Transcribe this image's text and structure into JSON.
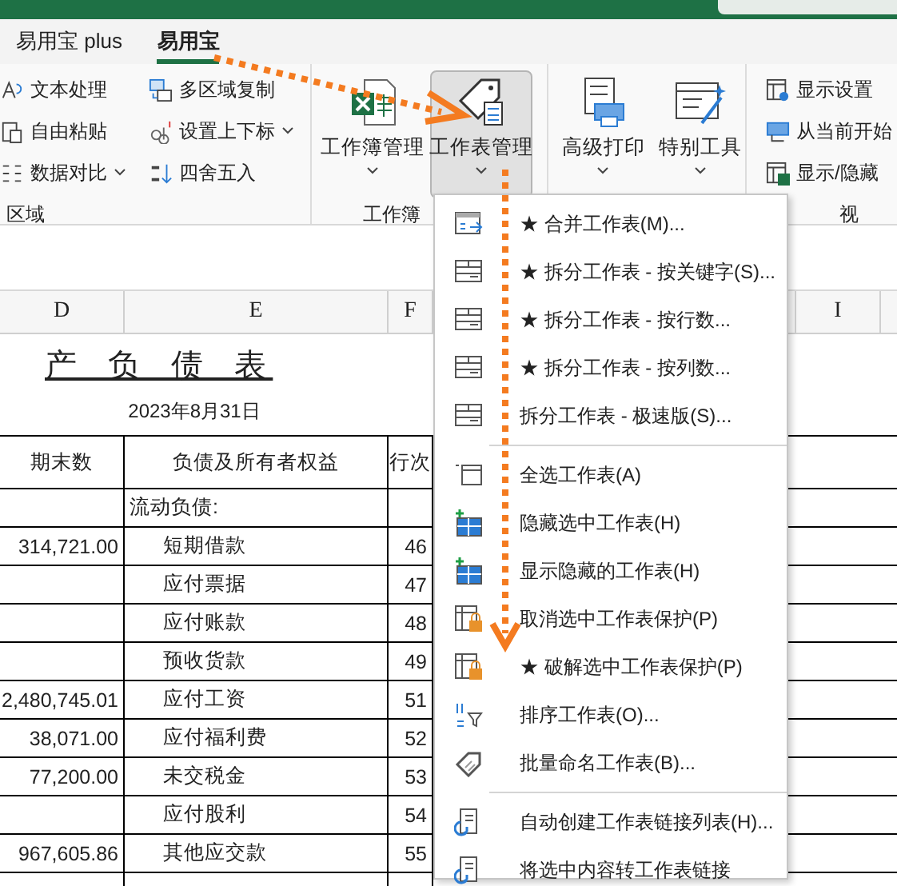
{
  "ribbon": {
    "tabs": [
      {
        "label": "易用宝 plus",
        "selected": false
      },
      {
        "label": "易用宝",
        "selected": true
      }
    ],
    "groups": [
      {
        "kind": "small",
        "label": "区域",
        "columns": [
          [
            {
              "label": "文本处理",
              "kind": "text",
              "dropdown": false
            },
            {
              "label": "自由粘贴",
              "kind": "paste",
              "dropdown": false
            },
            {
              "label": "数据对比",
              "kind": "compare",
              "dropdown": true
            }
          ],
          [
            {
              "label": "多区域复制",
              "kind": "copy",
              "dropdown": false
            },
            {
              "label": "设置上下标",
              "kind": "script",
              "dropdown": true
            },
            {
              "label": "四舍五入",
              "kind": "round",
              "dropdown": false
            }
          ]
        ]
      },
      {
        "kind": "large",
        "label": "工作簿",
        "buttons": [
          {
            "label": "工作簿管理",
            "kind": "workbook",
            "pressed": false
          },
          {
            "label": "工作表管理",
            "kind": "tag",
            "pressed": true
          }
        ]
      },
      {
        "kind": "large",
        "buttons": [
          {
            "label": "高级打印",
            "kind": "print",
            "pressed": false
          },
          {
            "label": "特别工具",
            "kind": "wand",
            "pressed": false
          }
        ]
      },
      {
        "kind": "small",
        "label": "视",
        "columns": [
          [
            {
              "label": "显示设置",
              "kind": "settings",
              "dropdown": false
            },
            {
              "label": "从当前开始",
              "kind": "screen",
              "dropdown": false
            },
            {
              "label": "显示/隐藏",
              "kind": "sheetx",
              "dropdown": false
            }
          ]
        ]
      }
    ]
  },
  "sheet": {
    "columns": [
      "D",
      "E",
      "F"
    ],
    "right_column": "I",
    "title": "产 负 债 表",
    "date": "2023年8月31日",
    "header": [
      "期末数",
      "负债及所有者权益",
      "行次"
    ],
    "rows": [
      {
        "kind": "section",
        "end_value": "",
        "item": "流动负债:",
        "line": ""
      },
      {
        "kind": "item",
        "end_value": "314,721.00",
        "item": "短期借款",
        "line": "46"
      },
      {
        "kind": "item",
        "end_value": "",
        "item": "应付票据",
        "line": "47"
      },
      {
        "kind": "item",
        "end_value": "",
        "item": "应付账款",
        "line": "48"
      },
      {
        "kind": "item",
        "end_value": "",
        "item": "预收货款",
        "line": "49"
      },
      {
        "kind": "item",
        "end_value": "2,480,745.01",
        "item": "应付工资",
        "line": "51"
      },
      {
        "kind": "item",
        "end_value": "38,071.00",
        "item": "应付福利费",
        "line": "52"
      },
      {
        "kind": "item",
        "end_value": "77,200.00",
        "item": "未交税金",
        "line": "53"
      },
      {
        "kind": "item",
        "end_value": "",
        "item": "应付股利",
        "line": "54"
      },
      {
        "kind": "item",
        "end_value": "967,605.86",
        "item": "其他应交款",
        "line": "55"
      }
    ]
  },
  "menu": {
    "groups": [
      [
        {
          "label": "★ 合并工作表(M)...",
          "kind": "merge"
        },
        {
          "label": "★ 拆分工作表 - 按关键字(S)...",
          "kind": "split"
        },
        {
          "label": "★ 拆分工作表 - 按行数...",
          "kind": "split"
        },
        {
          "label": "★ 拆分工作表 - 按列数...",
          "kind": "split"
        },
        {
          "label": "拆分工作表 - 极速版(S)...",
          "kind": "split"
        }
      ],
      [
        {
          "label": "全选工作表(A)",
          "kind": "select"
        },
        {
          "label": "隐藏选中工作表(H)",
          "kind": "grid"
        },
        {
          "label": "显示隐藏的工作表(H)",
          "kind": "grid"
        },
        {
          "label": "取消选中工作表保护(P)",
          "kind": "lock"
        },
        {
          "label": "★ 破解选中工作表保护(P)",
          "kind": "lock"
        },
        {
          "label": "排序工作表(O)...",
          "kind": "sort"
        },
        {
          "label": "批量命名工作表(B)...",
          "kind": "tag"
        }
      ],
      [
        {
          "label": "自动创建工作表链接列表(H)...",
          "kind": "link"
        },
        {
          "label": "将选中内容转工作表链接",
          "kind": "link"
        }
      ]
    ]
  }
}
